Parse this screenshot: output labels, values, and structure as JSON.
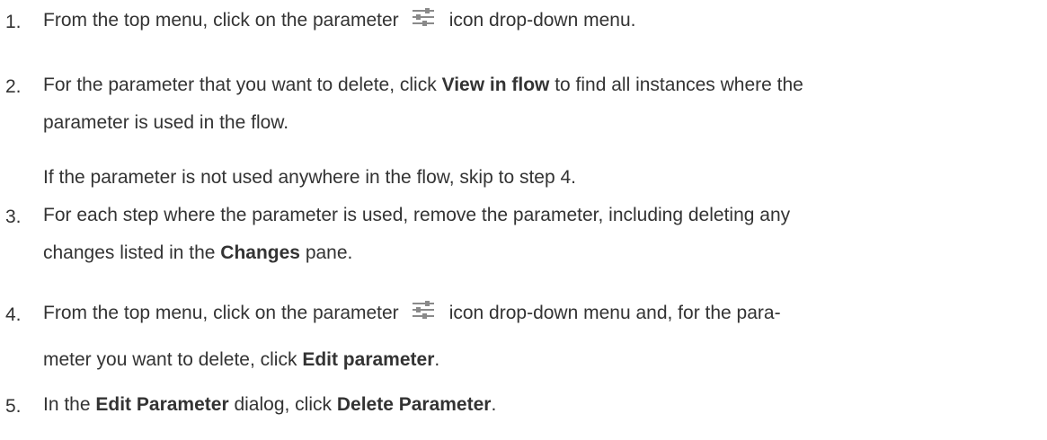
{
  "steps": [
    {
      "number": "1.",
      "text_before_icon": "From the top menu, click on the parameter",
      "icon": "parameter-sliders-icon",
      "text_after_icon": "icon drop-down menu."
    },
    {
      "number": "2.",
      "line1_pre": "For the parameter that you want to delete, click ",
      "line1_bold": "View in flow",
      "line1_post": " to find all instances where the",
      "line2": "parameter is used in the flow.",
      "note": "If the parameter is not used anywhere in the flow, skip to step 4."
    },
    {
      "number": "3.",
      "line1": "For each step where the parameter is used, remove the parameter, including deleting any",
      "line2_pre": "changes listed in the ",
      "line2_bold": "Changes",
      "line2_post": " pane."
    },
    {
      "number": "4.",
      "line1_pre": "From the top menu, click on the parameter",
      "icon": "parameter-sliders-icon",
      "line1_post": "icon drop-down menu and, for the para-",
      "line2_pre": "meter you want to delete, click ",
      "line2_bold": "Edit parameter",
      "line2_post": "."
    },
    {
      "number": "5.",
      "pre": "In the ",
      "bold1": "Edit Parameter",
      "mid": " dialog, click ",
      "bold2": "Delete Parameter",
      "post": "."
    }
  ],
  "colors": {
    "text": "#333333",
    "icon": "#8a8a8a"
  }
}
